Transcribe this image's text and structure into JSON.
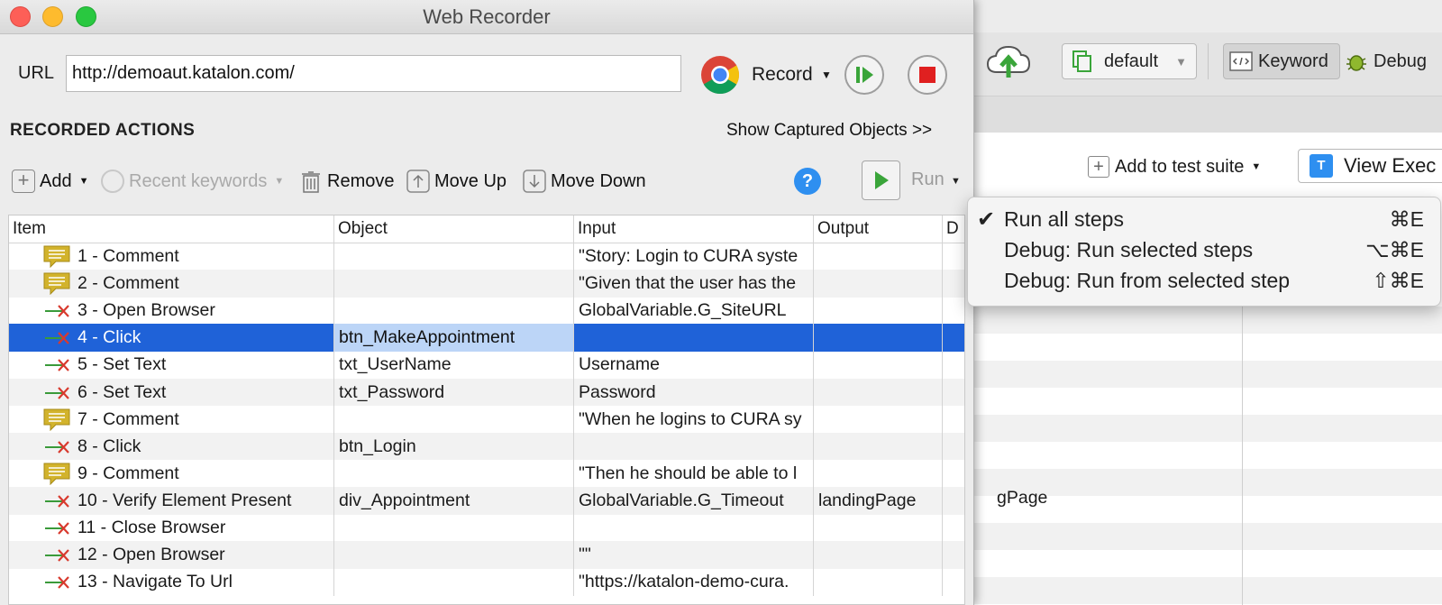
{
  "background_app": {
    "toolbar": {
      "profile_label": "default",
      "keyword_label": "Keyword",
      "debug_label": "Debug"
    },
    "add_to_suite_label": "Add to test suite",
    "view_exec_label": "View Exec",
    "partial_cell": "gPage"
  },
  "window": {
    "title": "Web Recorder",
    "url_label": "URL",
    "url_value": "http://demoaut.katalon.com/",
    "record_label": "Record",
    "recorded_actions_heading": "RECORDED ACTIONS",
    "show_captured_label": "Show Captured Objects >>"
  },
  "toolbar": {
    "add_label": "Add",
    "recent_keywords_label": "Recent keywords",
    "remove_label": "Remove",
    "move_up_label": "Move Up",
    "move_down_label": "Move Down",
    "help_glyph": "?",
    "run_label": "Run"
  },
  "table": {
    "columns": [
      "Item",
      "Object",
      "Input",
      "Output",
      "D"
    ],
    "rows": [
      {
        "icon": "comment-icon",
        "item": "1 - Comment",
        "object": "",
        "input": "\"Story: Login to CURA syste",
        "output": ""
      },
      {
        "icon": "comment-icon",
        "item": "2 - Comment",
        "object": "",
        "input": "\"Given that the user has the",
        "output": ""
      },
      {
        "icon": "keyword-icon",
        "item": "3 - Open Browser",
        "object": "",
        "input": "GlobalVariable.G_SiteURL",
        "output": ""
      },
      {
        "icon": "keyword-icon",
        "item": "4 - Click",
        "object": "btn_MakeAppointment",
        "input": "",
        "output": "",
        "selected": true
      },
      {
        "icon": "keyword-icon",
        "item": "5 - Set Text",
        "object": "txt_UserName",
        "input": "Username",
        "output": ""
      },
      {
        "icon": "keyword-icon",
        "item": "6 - Set Text",
        "object": "txt_Password",
        "input": "Password",
        "output": ""
      },
      {
        "icon": "comment-icon",
        "item": "7 - Comment",
        "object": "",
        "input": "\"When he logins to CURA sy",
        "output": ""
      },
      {
        "icon": "keyword-icon",
        "item": "8 - Click",
        "object": "btn_Login",
        "input": "",
        "output": ""
      },
      {
        "icon": "comment-icon",
        "item": "9 - Comment",
        "object": "",
        "input": "\"Then he should be able to l",
        "output": ""
      },
      {
        "icon": "keyword-icon",
        "item": "10 - Verify Element Present",
        "object": "div_Appointment",
        "input": "GlobalVariable.G_Timeout",
        "output": "landingPage"
      },
      {
        "icon": "keyword-icon",
        "item": "11 - Close Browser",
        "object": "",
        "input": "",
        "output": ""
      },
      {
        "icon": "keyword-icon",
        "item": "12 - Open Browser",
        "object": "",
        "input": "\"\"",
        "output": ""
      },
      {
        "icon": "keyword-icon",
        "item": "13 - Navigate To Url",
        "object": "",
        "input": "\"https://katalon-demo-cura.",
        "output": ""
      }
    ]
  },
  "run_menu": {
    "items": [
      {
        "label": "Run all steps",
        "shortcut": "⌘E",
        "checked": true
      },
      {
        "label": "Debug: Run selected steps",
        "shortcut": "⌥⌘E",
        "checked": false
      },
      {
        "label": "Debug: Run from selected step",
        "shortcut": "⇧⌘E",
        "checked": false
      }
    ]
  },
  "colors": {
    "selection": "#1f62d8",
    "selection_object_cell": "#bcd5f7",
    "comment_icon": "#d2b32c",
    "keyword_icon_arrow": "#3a9a3a",
    "keyword_icon_x": "#d83a2e",
    "help_icon": "#2e8ff0"
  }
}
